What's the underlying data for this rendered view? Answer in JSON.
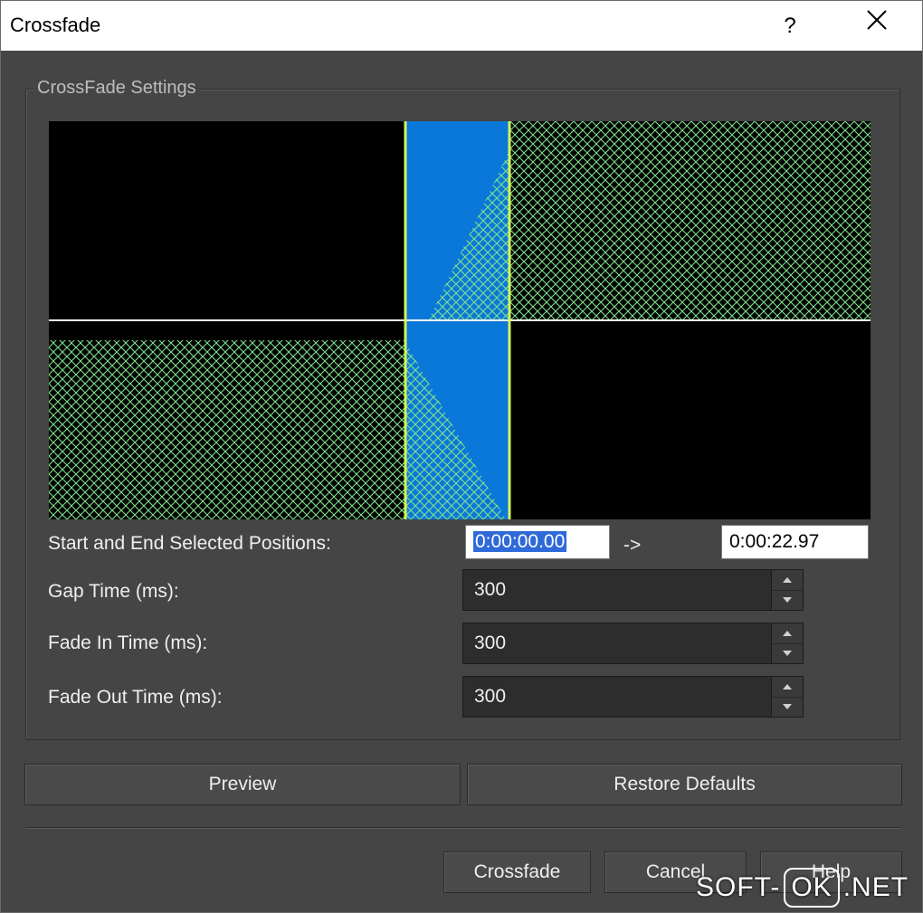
{
  "window": {
    "title": "Crossfade",
    "help_symbol": "?"
  },
  "settings": {
    "group_label": "CrossFade Settings",
    "positions_label": "Start and End Selected Positions:",
    "start_position": "0:00:00.00",
    "arrow": "->",
    "end_position": "0:00:22.97",
    "gap_label": "Gap Time (ms):",
    "gap_value": "300",
    "fade_in_label": "Fade In Time (ms):",
    "fade_in_value": "300",
    "fade_out_label": "Fade Out Time (ms):",
    "fade_out_value": "300"
  },
  "buttons": {
    "preview": "Preview",
    "restore_defaults": "Restore Defaults",
    "crossfade": "Crossfade",
    "cancel": "Cancel",
    "help": "Help"
  },
  "watermark": {
    "prefix": "SOFT-",
    "boxed": "OK",
    "suffix": ".NET"
  },
  "colors": {
    "dialog_bg": "#454545",
    "waveform_bg": "#000000",
    "selection_fill": "#0a78d8",
    "crosshatch": "#7fe08c",
    "marker_line": "#d6f55a"
  },
  "icons": [
    "close-icon",
    "help-icon",
    "spin-up-icon",
    "spin-down-icon"
  ]
}
